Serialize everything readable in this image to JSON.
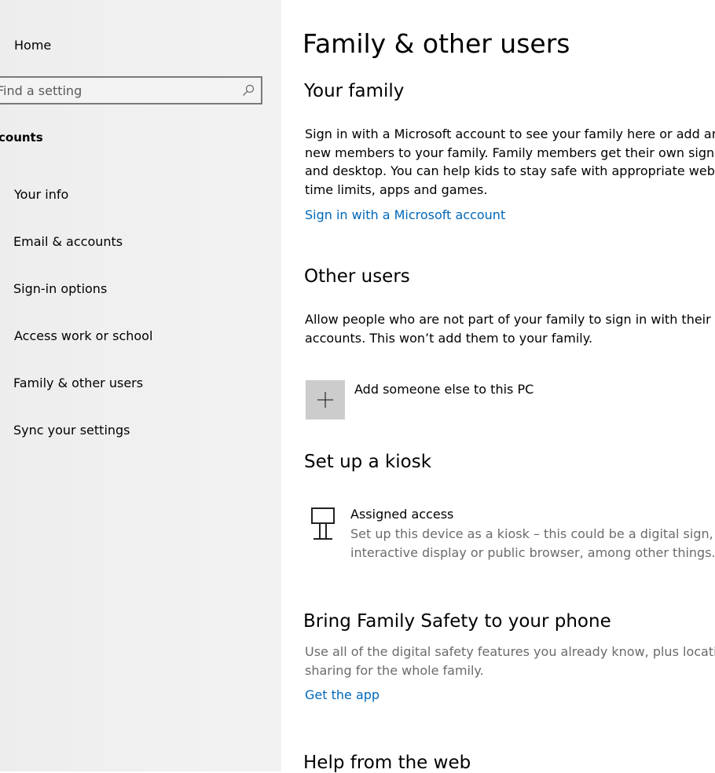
{
  "sidebar": {
    "home_label": "Home",
    "search_placeholder": "Find a setting",
    "section_label": "counts",
    "items": [
      {
        "label": "Your info"
      },
      {
        "label": "Email & accounts"
      },
      {
        "label": "Sign-in options"
      },
      {
        "label": "Access work or school"
      },
      {
        "label": "Family & other users"
      },
      {
        "label": "Sync your settings"
      }
    ]
  },
  "main": {
    "title": "Family & other users",
    "your_family": {
      "heading": "Your family",
      "lines": [
        "Sign in with a Microsoft account to see your family here or add any",
        "new members to your family. Family members get their own sign-in",
        "and desktop. You can help kids to stay safe with appropriate website",
        "time limits, apps and games."
      ],
      "link": "Sign in with a Microsoft account"
    },
    "other_users": {
      "heading": "Other users",
      "lines": [
        "Allow people who are not part of your family to sign in with their ov",
        "accounts. This won’t add them to your family."
      ],
      "add_label": "Add someone else to this PC",
      "add_icon": "plus-icon"
    },
    "kiosk": {
      "heading": "Set up a kiosk",
      "item_title": "Assigned access",
      "item_desc_lines": [
        "Set up this device as a kiosk – this could be a digital sign,",
        "interactive display or public browser, among other things."
      ],
      "icon": "kiosk-icon"
    },
    "family_safety": {
      "heading": "Bring Family Safety to your phone",
      "lines": [
        "Use all of the digital safety features you already know, plus location",
        "sharing for the whole family."
      ],
      "link": "Get the app"
    },
    "help": {
      "heading": "Help from the web"
    }
  },
  "colors": {
    "link": "#0067b8",
    "sidebar_bg": "#f0f0f0",
    "tile_bg": "#cccccc",
    "secondary_text": "#6b6b6b"
  }
}
